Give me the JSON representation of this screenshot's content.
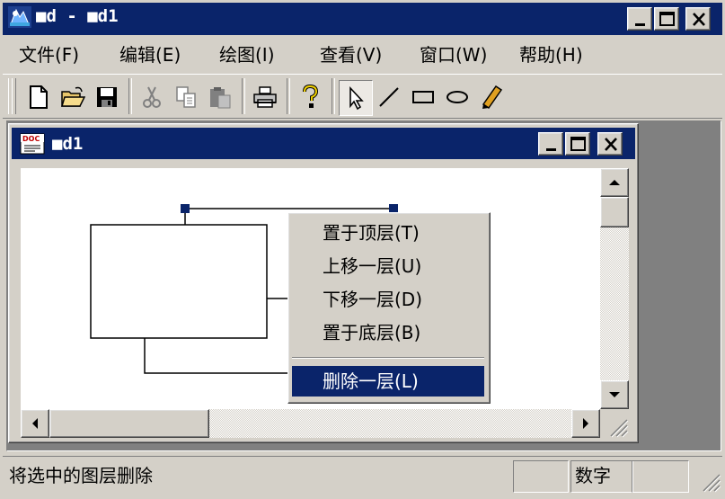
{
  "app": {
    "title": "■d - ■d1"
  },
  "menu": [
    {
      "label": "文件(F)"
    },
    {
      "label": "编辑(E)"
    },
    {
      "label": "绘图(I)"
    },
    {
      "label": "查看(V)"
    },
    {
      "label": "窗口(W)"
    },
    {
      "label": "帮助(H)"
    }
  ],
  "toolbar": {
    "buttons": [
      "new-icon",
      "open-icon",
      "save-icon",
      "cut-icon",
      "copy-icon",
      "paste-icon",
      "print-icon",
      "help-icon",
      "select-arrow-icon",
      "line-tool-icon",
      "rectangle-tool-icon",
      "ellipse-tool-icon",
      "pencil-tool-icon"
    ],
    "active": "select-arrow-icon"
  },
  "child": {
    "title": "■d1",
    "icon_label": "DOC"
  },
  "context_menu": {
    "items": [
      {
        "label": "置于顶层(T)"
      },
      {
        "label": "上移一层(U)"
      },
      {
        "label": "下移一层(D)"
      },
      {
        "label": "置于底层(B)"
      },
      {
        "label": "删除一层(L)"
      }
    ],
    "selected_index": 4
  },
  "status": {
    "message": "将选中的图层删除",
    "num_indicator": "数字"
  },
  "colors": {
    "titlebar": "#0a246a",
    "face": "#d4d0c8",
    "mdi_bg": "#808080",
    "selection": "#0a246a"
  }
}
